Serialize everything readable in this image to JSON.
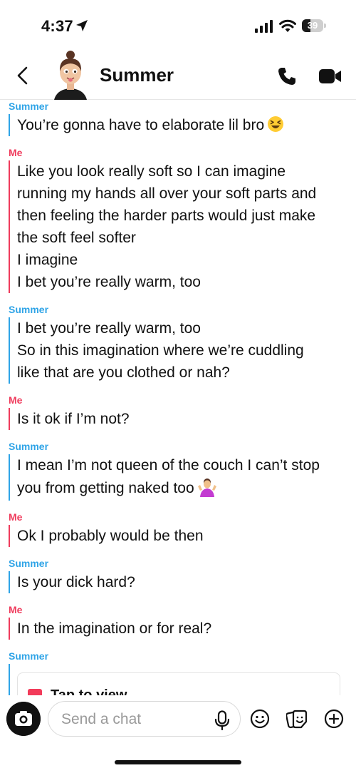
{
  "status_bar": {
    "time": "4:37",
    "battery_level": "39",
    "battery_fraction": 0.39
  },
  "header": {
    "contact_name": "Summer"
  },
  "messages": [
    {
      "sender": "Summer",
      "lines": [
        "You’re gonna have to elaborate lil bro"
      ]
    },
    {
      "sender": "Me",
      "lines": [
        "Like you look really soft so I can imagine",
        "running my hands all over your soft parts and",
        "then feeling the harder parts would just make",
        "the soft feel softer",
        "I imagine",
        "I bet you’re really warm, too"
      ]
    },
    {
      "sender": "Summer",
      "lines": [
        "I bet you’re really warm, too",
        "So in this imagination where we’re cuddling",
        "like that are you clothed or nah?"
      ]
    },
    {
      "sender": "Me",
      "lines": [
        "Is it ok if I’m not?"
      ]
    },
    {
      "sender": "Summer",
      "lines": [
        "I mean I’m not queen of the couch I can’t stop",
        "you from getting naked too"
      ]
    },
    {
      "sender": "Me",
      "lines": [
        "Ok I probably would be then"
      ]
    },
    {
      "sender": "Summer",
      "lines": [
        "Is your dick hard?"
      ]
    },
    {
      "sender": "Me",
      "lines": [
        "In the imagination or for real?"
      ]
    },
    {
      "sender": "Summer",
      "snap": "Tap to view"
    }
  ],
  "composer": {
    "placeholder": "Send a chat"
  },
  "colors": {
    "summer": "#2fa4e7",
    "me": "#ef3b5c",
    "snap": "#f23b5a"
  },
  "icons": [
    "location-arrow-icon",
    "signal-icon",
    "wifi-icon",
    "battery-icon",
    "back-icon",
    "avatar",
    "phone-icon",
    "video-icon",
    "grinning-squint-emoji",
    "shrug-emoji",
    "camera-icon",
    "microphone-icon",
    "emoji-icon",
    "sticker-icon",
    "plus-icon"
  ]
}
